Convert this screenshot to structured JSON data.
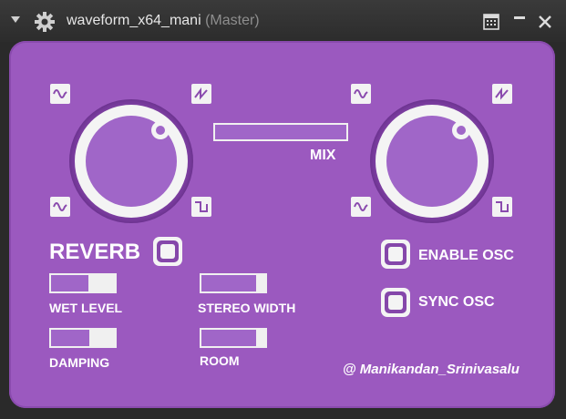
{
  "window": {
    "title": "waveform_x64_mani",
    "subtitle": "(Master)",
    "icons": [
      "dropdown-arrow-icon",
      "gear-icon",
      "grid-icon",
      "minimize-icon",
      "close-icon"
    ]
  },
  "plugin": {
    "mix_label": "MIX",
    "mix_value": 1.0,
    "reverb_label": "REVERB",
    "wet_level_label": "WET LEVEL",
    "wet_level_value": 0.58,
    "stereo_width_label": "STEREO WIDTH",
    "stereo_width_value": 0.85,
    "damping_label": "DAMPING",
    "damping_value": 0.6,
    "room_label": "ROOM",
    "room_value": 0.85,
    "enable_osc_label": "ENABLE OSC",
    "sync_osc_label": "SYNC OSC",
    "credit": "@ Manikandan_Srinivasalu",
    "left_knob_icons": [
      "sine-wave-icon",
      "sawtooth-wave-icon",
      "sine-wave-icon",
      "square-wave-icon"
    ],
    "right_knob_icons": [
      "sine-wave-icon",
      "sawtooth-wave-icon",
      "sine-wave-icon",
      "square-wave-icon"
    ]
  },
  "colors": {
    "panel": "#9b59bf",
    "accent_light": "#a066c8",
    "white": "#f4f4f4",
    "titlebar": "#2c2c2c"
  }
}
